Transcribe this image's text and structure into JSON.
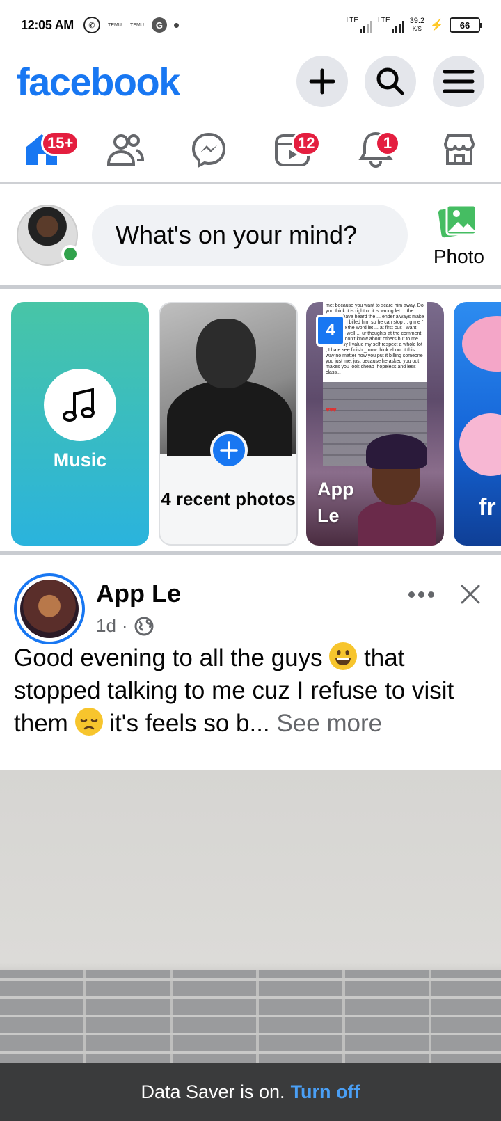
{
  "status_bar": {
    "time": "12:05 AM",
    "temu_1": "TEMU",
    "temu_2": "TEMU",
    "network_1": "LTE",
    "network_2": "LTE",
    "speed": "39.2",
    "speed_unit": "K/S",
    "battery": "66"
  },
  "header": {
    "logo": "facebook"
  },
  "nav": {
    "home_badge": "15+",
    "video_badge": "12",
    "notifications_badge": "1"
  },
  "composer": {
    "placeholder": "What's on your mind?",
    "photo_label": "Photo"
  },
  "stories": [
    {
      "label": "Music"
    },
    {
      "label": "4 recent photos"
    },
    {
      "label_line1": "App",
      "label_line2": "Le",
      "count": "4",
      "note": "met because you want to scare him away. Do you think it is right or it is wrong let ... the topic : I have heard the ... ender always make that ... t \" I billed him so he can stop ... g me \" now I use the word let ... at first cus I want you to as well ... ur thoughts at the comment ... Now I don't know about others but to me personally I value my self respect a whole lot , I hate see finish _ now think about it this way no matter how you put it billing someone you just met just because he asked you out makes you look cheap ,hopeless and less class...",
      "hearts": "♥♥♥"
    },
    {
      "label": "fr"
    }
  ],
  "post": {
    "author": "App Le",
    "time": "1d",
    "separator": "·",
    "text_part1": "Good evening to all the guys ",
    "text_part2": " that stopped talking to me cuz I refuse to visit them ",
    "text_part3": " it's feels so b...",
    "see_more": "See more"
  },
  "data_saver": {
    "message": "Data Saver is on.",
    "action": "Turn off"
  },
  "colors": {
    "brand": "#1877f2",
    "badge": "#e41e3f",
    "online": "#31a24c",
    "data_saver_bg": "#3a3b3c",
    "link": "#4a9ff5"
  }
}
